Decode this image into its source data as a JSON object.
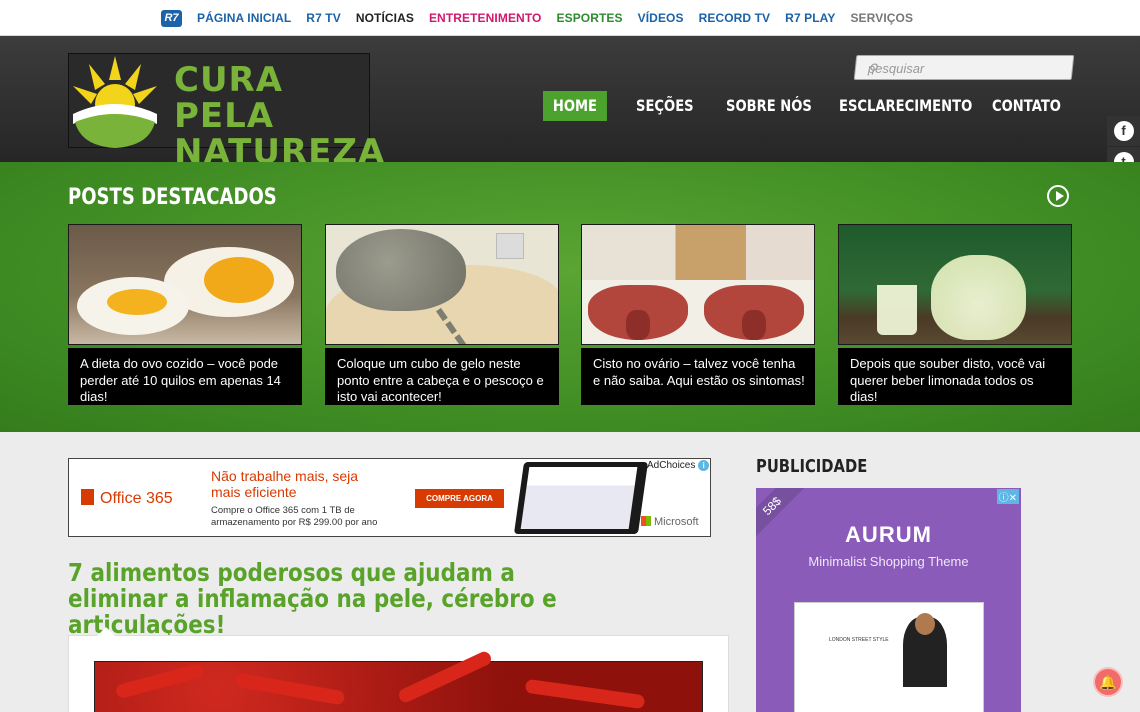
{
  "topbar": {
    "logo": "R7",
    "items": [
      {
        "label": "PÁGINA INICIAL",
        "color": "#1b62a8"
      },
      {
        "label": "R7 TV",
        "color": "#1b62a8"
      },
      {
        "label": "NOTÍCIAS",
        "color": "#222222"
      },
      {
        "label": "ENTRETENIMENTO",
        "color": "#d0186f"
      },
      {
        "label": "ESPORTES",
        "color": "#2e8b2e"
      },
      {
        "label": "VÍDEOS",
        "color": "#1b62a8"
      },
      {
        "label": "RECORD TV",
        "color": "#1b62a8"
      },
      {
        "label": "R7 PLAY",
        "color": "#1b62a8"
      },
      {
        "label": "SERVIÇOS",
        "color": "#777777"
      }
    ]
  },
  "header": {
    "logo_line1": "CURA PELA",
    "logo_line2": "NATUREZA",
    "search_placeholder": "pesquisar",
    "nav": [
      {
        "label": "HOME",
        "active": true
      },
      {
        "label": "SEÇÕES"
      },
      {
        "label": "SOBRE NÓS"
      },
      {
        "label": "ESCLARECIMENTO"
      },
      {
        "label": "CONTATO"
      }
    ]
  },
  "social": [
    {
      "icon": "facebook-icon",
      "glyph": "f"
    },
    {
      "icon": "twitter-icon",
      "glyph": "t"
    },
    {
      "icon": "rss-icon",
      "glyph": "◉"
    }
  ],
  "featured": {
    "title": "POSTS DESTACADOS",
    "posts": [
      {
        "caption": "A dieta do ovo cozido – você pode perder até 10 quilos em apenas 14 dias!"
      },
      {
        "caption": "Coloque um cubo de gelo neste ponto entre a cabeça e o pescoço e isto vai acontecer!"
      },
      {
        "caption": "Cisto no ovário – talvez você tenha e não saiba. Aqui estão os sintomas!"
      },
      {
        "caption": "Depois que souber disto, você vai querer beber limonada todos os dias!"
      }
    ]
  },
  "ad_banner": {
    "brand": "Office 365",
    "headline": "Não trabalhe mais, seja mais eficiente",
    "subtext": "Compre o Office 365 com 1 TB de armazenamento por R$ 299.00 por ano",
    "cta": "COMPRE AGORA",
    "adchoices": "AdChoices",
    "sponsor": "Microsoft"
  },
  "article": {
    "title": "7 alimentos poderosos que ajudam a eliminar a inflamação na pele, cérebro e articulações!"
  },
  "sidebar": {
    "title": "PUBLICIDADE",
    "ad": {
      "price": "58$",
      "brand": "AURUM",
      "tagline": "Minimalist Shopping Theme",
      "screen_text": "LONDON STREET STYLE"
    }
  },
  "colors": {
    "accent_green": "#4da22e",
    "title_green": "#5aa32a",
    "office_orange": "#d83b01",
    "ad_purple": "#8a5bb8"
  }
}
